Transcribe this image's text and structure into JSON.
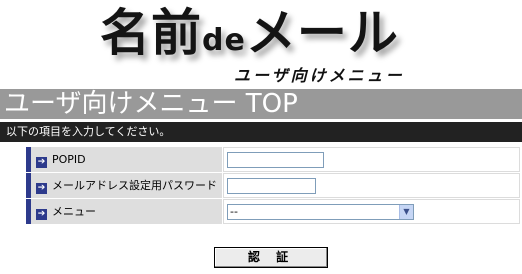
{
  "logo": {
    "name_part": "名前",
    "de": "de",
    "mail_part": "メール",
    "subtitle": "ユーザ向けメニュー"
  },
  "page_title": "ユーザ向けメニュー TOP",
  "instruction": "以下の項目を入力してください。",
  "form": {
    "rows": [
      {
        "label": "POPID",
        "value": ""
      },
      {
        "label": "メールアドレス設定用パスワード",
        "value": ""
      },
      {
        "label": "メニュー",
        "selected": "--"
      }
    ]
  },
  "auth_button": "認 証",
  "icons": {
    "row_marker": "arrow-right-icon",
    "select_caret": "chevron-down-icon"
  },
  "colors": {
    "title_bar": "#999999",
    "instruction_bar": "#222222",
    "row_marker": "#2d3a8c",
    "label_bg": "#dedede"
  }
}
